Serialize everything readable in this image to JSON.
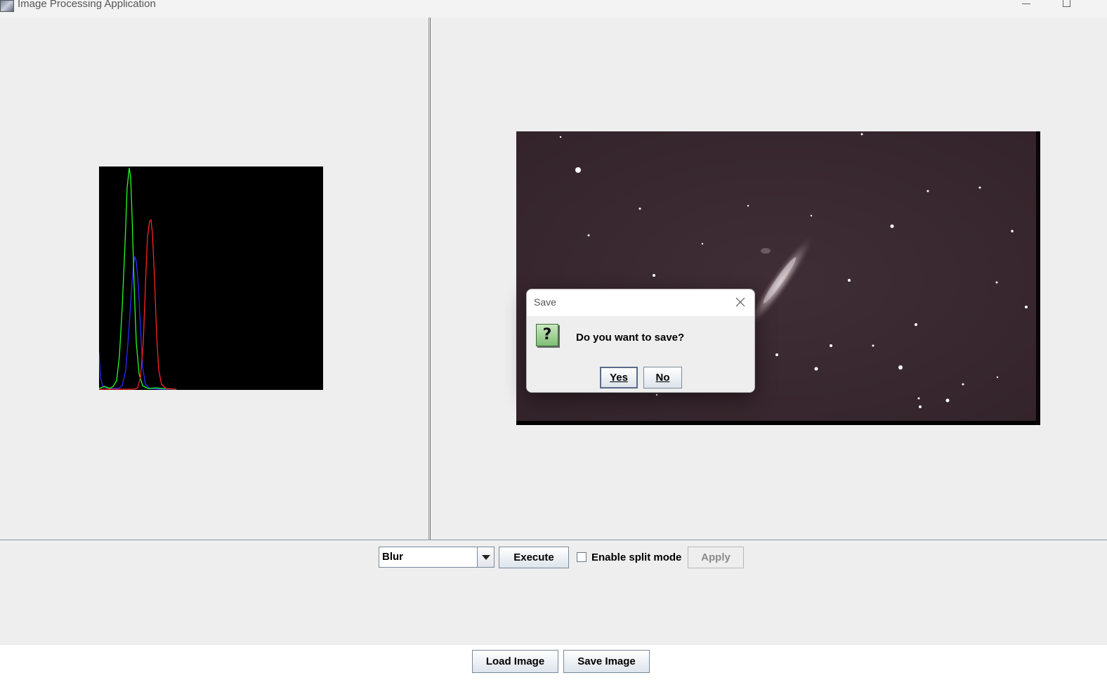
{
  "window": {
    "title": "Image Processing Application",
    "icon": "app-icon",
    "controls": [
      "minimize-icon",
      "maximize-icon"
    ]
  },
  "histogram": {
    "background": "#000000",
    "channels": [
      {
        "color": "#ff2020",
        "name": "red"
      },
      {
        "color": "#20ff20",
        "name": "green"
      },
      {
        "color": "#2020ff",
        "name": "blue"
      }
    ]
  },
  "image_preview": {
    "background": "#3a2a30"
  },
  "toolbar": {
    "operation_selected": "Blur",
    "execute_label": "Execute",
    "split_mode_label": "Enable split mode",
    "split_mode_checked": false,
    "apply_label": "Apply",
    "apply_enabled": false
  },
  "footer": {
    "load_label": "Load Image",
    "save_label": "Save Image"
  },
  "dialog": {
    "title": "Save",
    "message": "Do you want to save?",
    "icon": "question-icon",
    "yes_label": "Yes",
    "no_label": "No"
  }
}
